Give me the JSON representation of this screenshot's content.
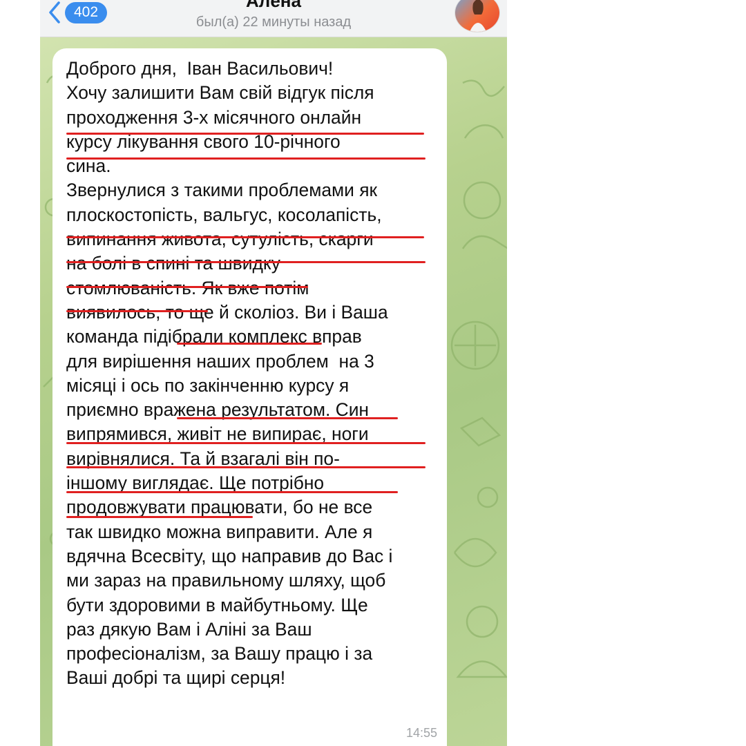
{
  "header": {
    "back_count": "402",
    "contact_name": "Алёна",
    "last_seen": "был(а) 22 минуты назад"
  },
  "message": {
    "lines": [
      "Доброго дня,  Іван Васильович!",
      "Хочу залишити Вам свій відгук після",
      "проходження 3-х місячного онлайн",
      "курсу лікування свого 10-річного",
      "сина.",
      "Звернулися з такими проблемами як",
      "плоскостопість, вальгус, косолапість,",
      "випинання живота, сутулість, скарги",
      "на болі в спині та швидку",
      "стомлюваність. Як вже потім",
      "виявилось, то ще й сколіоз. Ви і Ваша",
      "команда підібрали комплекс вправ",
      "для вирішення наших проблем  на 3",
      "місяці і ось по закінченню курсу я",
      "приємно вражена результатом. Син",
      "випрямився, живіт не випирає, ноги",
      "вирівнялися. Та й взагалі він по-",
      "іншому виглядає. Ще потрібно",
      "продовжувати працювати, бо не все",
      "так швидко можна виправити. Але я",
      "вдячна Всесвіту, що направив до Вас і",
      "ми зараз на правильному шляху, щоб",
      "бути здоровими в майбутньому. Ще",
      "раз дякую Вам і Аліні за Ваш",
      "професіоналізм, за Вашу працю і за",
      "Ваші добрі та щирі серця!"
    ],
    "time": "14:55"
  },
  "colors": {
    "accent": "#3a8dee",
    "underline": "#e02020",
    "chat_background": "#b7d18e"
  },
  "icons": [
    "chevron-left-icon",
    "avatar"
  ]
}
